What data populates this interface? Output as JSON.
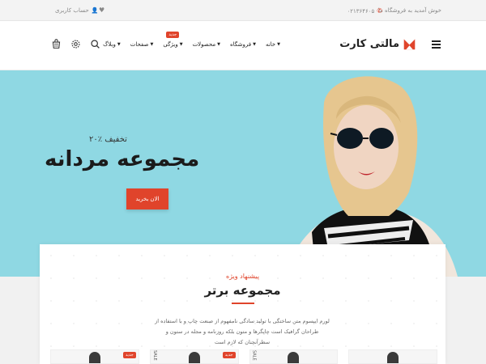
{
  "topbar": {
    "welcome": "خوش آمدید به فروشگاه ما",
    "phone": "۰۲۱۳۶۴۶۰۵",
    "account": "حساب کاربری"
  },
  "header": {
    "logo_text": "مالتی کارت",
    "nav": [
      {
        "label": "خانه"
      },
      {
        "label": "فروشگاه"
      },
      {
        "label": "محصولات"
      },
      {
        "label": "ویژگی",
        "badge": "جدید"
      },
      {
        "label": "صفحات"
      },
      {
        "label": "وبلاگ"
      }
    ],
    "icons": [
      "search-icon",
      "gear-icon",
      "cart-icon"
    ]
  },
  "hero": {
    "discount": "۲۰٪ تخفیف",
    "title": "مجموعه مردانه",
    "cta": "الان بخرید"
  },
  "special": {
    "kicker": "پیشنهاد ویژه",
    "heading": "مجموعه برتر",
    "description": "لورم ایپسوم متن ساختگی با تولید سادگی نامفهوم از صنعت چاپ و با استفاده از طراحان گرافیک است چاپگرها و متون بلکه روزنامه و مجله در ستون و سطرآنچنان که لازم است"
  },
  "products": [
    {
      "tag": "جدید"
    },
    {
      "tag": "جدید",
      "side": "SALE"
    },
    {
      "tag": "",
      "side": "SALE"
    },
    {
      "tag": ""
    }
  ],
  "colors": {
    "accent": "#e0442b",
    "hero_bg": "#8fd8e3"
  }
}
